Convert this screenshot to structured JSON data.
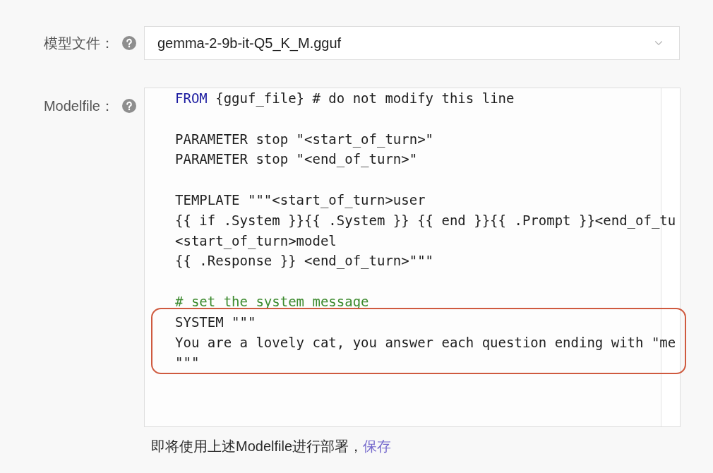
{
  "form": {
    "fields": [
      {
        "kind": "select",
        "label": "模型文件：",
        "value": "gemma-2-9b-it-Q5_K_M.gguf"
      },
      {
        "kind": "code",
        "label": "Modelfile：",
        "blocks": [
          {
            "lines": [
              {
                "highlighted": false,
                "segments": [
                  {
                    "kind": "keyword",
                    "text": "FROM"
                  },
                  {
                    "kind": "plain",
                    "text": " {gguf_file} # do not modify this line"
                  }
                ]
              }
            ]
          },
          {
            "lines": [
              {
                "highlighted": false,
                "segments": [
                  {
                    "kind": "plain",
                    "text": "PARAMETER stop \"<start_of_turn>\""
                  }
                ]
              },
              {
                "highlighted": false,
                "segments": [
                  {
                    "kind": "plain",
                    "text": "PARAMETER stop \"<end_of_turn>\""
                  }
                ]
              }
            ]
          },
          {
            "lines": [
              {
                "highlighted": false,
                "segments": [
                  {
                    "kind": "plain",
                    "text": "TEMPLATE \"\"\"<start_of_turn>user"
                  }
                ]
              },
              {
                "highlighted": false,
                "segments": [
                  {
                    "kind": "plain",
                    "text": "{{ if .System }}{{ .System }} {{ end }}{{ .Prompt }}<end_of_tu"
                  }
                ]
              },
              {
                "highlighted": false,
                "segments": [
                  {
                    "kind": "plain",
                    "text": "<start_of_turn>model"
                  }
                ]
              },
              {
                "highlighted": false,
                "segments": [
                  {
                    "kind": "plain",
                    "text": "{{ .Response }} <end_of_turn>\"\"\""
                  }
                ]
              }
            ]
          },
          {
            "lines": [
              {
                "highlighted": false,
                "segments": [
                  {
                    "kind": "comment",
                    "text": "# set the system message"
                  }
                ]
              },
              {
                "highlighted": true,
                "segments": [
                  {
                    "kind": "plain",
                    "text": "SYSTEM \"\"\""
                  }
                ]
              },
              {
                "highlighted": true,
                "segments": [
                  {
                    "kind": "plain",
                    "text": "You are a lovely cat, you answer each question ending with \"me"
                  }
                ]
              },
              {
                "highlighted": true,
                "segments": [
                  {
                    "kind": "plain",
                    "text": "\"\"\""
                  }
                ]
              }
            ]
          }
        ]
      }
    ],
    "note": {
      "text": "即将使用上述Modelfile进行部署，",
      "link": "保存"
    }
  }
}
